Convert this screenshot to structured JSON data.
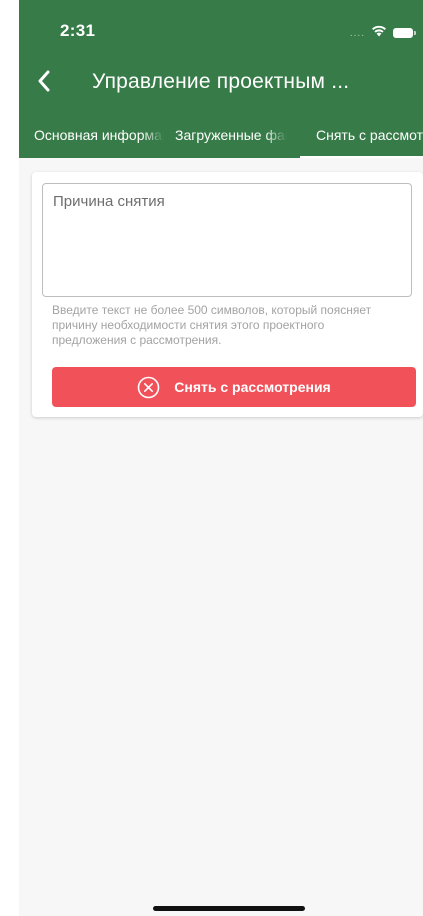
{
  "status_bar": {
    "time": "2:31",
    "signal": "....",
    "icons": [
      "wifi-icon",
      "battery-icon"
    ]
  },
  "navbar": {
    "back_icon": "chevron-left-icon",
    "title": "Управление проектным ..."
  },
  "tabs": [
    {
      "label": "Основная информация",
      "active": false
    },
    {
      "label": "Загруженные файлы",
      "active": false
    },
    {
      "label": "Снять с рассмотрения",
      "active": true
    }
  ],
  "form": {
    "reason_placeholder": "Причина снятия",
    "reason_value": "",
    "helper_text": "Введите текст не более 500 символов, который поясняет причину необходимости снятия этого проектного предложения с рассмотрения.",
    "submit_label": "Снять с рассмотрения",
    "submit_icon": "close-circle-icon"
  },
  "colors": {
    "header": "#367b48",
    "background": "#f7f7f7",
    "submit_button": "#f1525a",
    "helper_text": "#a3a3a3"
  }
}
